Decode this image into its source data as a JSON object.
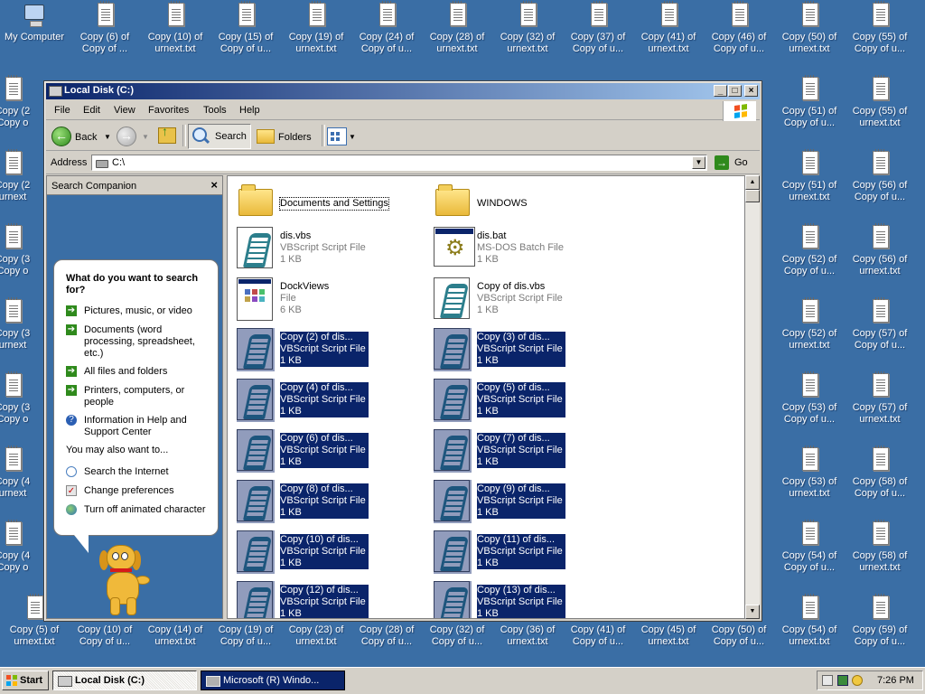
{
  "desktop": {
    "my_computer": "My Computer",
    "top_row": [
      [
        "Copy (6) of",
        "Copy of ..."
      ],
      [
        "Copy (10) of",
        "urnext.txt"
      ],
      [
        "Copy (15) of",
        "Copy of u..."
      ],
      [
        "Copy (19) of",
        "urnext.txt"
      ],
      [
        "Copy (24) of",
        "Copy of u..."
      ],
      [
        "Copy (28) of",
        "urnext.txt"
      ],
      [
        "Copy (32) of",
        "urnext.txt"
      ],
      [
        "Copy (37) of",
        "Copy of u..."
      ],
      [
        "Copy (41) of",
        "urnext.txt"
      ],
      [
        "Copy (46) of",
        "Copy of u..."
      ],
      [
        "Copy (50) of",
        "urnext.txt"
      ],
      [
        "Copy (55) of",
        "Copy of u..."
      ]
    ],
    "left_col": [
      [
        "Copy (2",
        "Copy o"
      ],
      [
        "Copy (2",
        "urnext"
      ],
      [
        "Copy (3",
        "Copy o"
      ],
      [
        "Copy (3",
        "urnext"
      ],
      [
        "Copy (3",
        "Copy o"
      ],
      [
        "Copy (4",
        "urnext"
      ],
      [
        "Copy (4",
        "Copy o"
      ]
    ],
    "right_col_a": [
      [
        "Copy (51) of",
        "Copy of u..."
      ],
      [
        "Copy (51) of",
        "urnext.txt"
      ],
      [
        "Copy (52) of",
        "Copy of u..."
      ],
      [
        "Copy (52) of",
        "urnext.txt"
      ],
      [
        "Copy (53) of",
        "Copy of u..."
      ],
      [
        "Copy (53) of",
        "urnext.txt"
      ],
      [
        "Copy (54) of",
        "Copy of u..."
      ]
    ],
    "right_col_b": [
      [
        "Copy (55) of",
        "urnext.txt"
      ],
      [
        "Copy (56) of",
        "Copy of u..."
      ],
      [
        "Copy (56) of",
        "urnext.txt"
      ],
      [
        "Copy (57) of",
        "Copy of u..."
      ],
      [
        "Copy (57) of",
        "urnext.txt"
      ],
      [
        "Copy (58) of",
        "Copy of u..."
      ],
      [
        "Copy (58) of",
        "urnext.txt"
      ]
    ],
    "bottom_row": [
      [
        "Copy (5) of",
        "urnext.txt"
      ],
      [
        "Copy (10) of",
        "Copy of u..."
      ],
      [
        "Copy (14) of",
        "urnext.txt"
      ],
      [
        "Copy (19) of",
        "Copy of u..."
      ],
      [
        "Copy (23) of",
        "urnext.txt"
      ],
      [
        "Copy (28) of",
        "Copy of u..."
      ],
      [
        "Copy (32) of",
        "Copy of u..."
      ],
      [
        "Copy (36) of",
        "urnext.txt"
      ],
      [
        "Copy (41) of",
        "Copy of u..."
      ],
      [
        "Copy (45) of",
        "urnext.txt"
      ],
      [
        "Copy (50) of",
        "Copy of u..."
      ],
      [
        "Copy (54) of",
        "urnext.txt"
      ],
      [
        "Copy (59) of",
        "Copy of u..."
      ]
    ]
  },
  "window": {
    "title": "Local Disk (C:)",
    "menu": [
      "File",
      "Edit",
      "View",
      "Favorites",
      "Tools",
      "Help"
    ],
    "toolbar": {
      "back": "Back",
      "search": "Search",
      "folders": "Folders"
    },
    "address_label": "Address",
    "address_value": "C:\\",
    "go_label": "Go"
  },
  "companion": {
    "title": "Search Companion",
    "close": "×",
    "question": "What do you want to search for?",
    "options": [
      "Pictures, music, or video",
      "Documents (word processing, spreadsheet, etc.)",
      "All files and folders",
      "Printers, computers, or people",
      "Information in Help and Support Center"
    ],
    "also_label": "You may also want to...",
    "also": [
      "Search the Internet",
      "Change preferences",
      "Turn off animated character"
    ]
  },
  "files": [
    {
      "name": "Documents and Settings",
      "type": "",
      "size": "",
      "icon": "folder",
      "selected": false
    },
    {
      "name": "WINDOWS",
      "type": "",
      "size": "",
      "icon": "folder",
      "selected": false
    },
    {
      "name": "dis.vbs",
      "type": "VBScript Script File",
      "size": "1 KB",
      "icon": "vbs",
      "selected": false
    },
    {
      "name": "dis.bat",
      "type": "MS-DOS Batch File",
      "size": "1 KB",
      "icon": "bat",
      "selected": false
    },
    {
      "name": "DockViews",
      "type": "File",
      "size": "6 KB",
      "icon": "file",
      "selected": false
    },
    {
      "name": "Copy of dis.vbs",
      "type": "VBScript Script File",
      "size": "1 KB",
      "icon": "vbs",
      "selected": false
    },
    {
      "name": "Copy (2) of dis...",
      "type": "VBScript Script File",
      "size": "1 KB",
      "icon": "vbs",
      "selected": true
    },
    {
      "name": "Copy (3) of dis...",
      "type": "VBScript Script File",
      "size": "1 KB",
      "icon": "vbs",
      "selected": true
    },
    {
      "name": "Copy (4) of dis...",
      "type": "VBScript Script File",
      "size": "1 KB",
      "icon": "vbs",
      "selected": true
    },
    {
      "name": "Copy (5) of dis...",
      "type": "VBScript Script File",
      "size": "1 KB",
      "icon": "vbs",
      "selected": true
    },
    {
      "name": "Copy (6) of dis...",
      "type": "VBScript Script File",
      "size": "1 KB",
      "icon": "vbs",
      "selected": true
    },
    {
      "name": "Copy (7) of dis...",
      "type": "VBScript Script File",
      "size": "1 KB",
      "icon": "vbs",
      "selected": true
    },
    {
      "name": "Copy (8) of dis...",
      "type": "VBScript Script File",
      "size": "1 KB",
      "icon": "vbs",
      "selected": true
    },
    {
      "name": "Copy (9) of dis...",
      "type": "VBScript Script File",
      "size": "1 KB",
      "icon": "vbs",
      "selected": true
    },
    {
      "name": "Copy (10) of dis...",
      "type": "VBScript Script File",
      "size": "1 KB",
      "icon": "vbs",
      "selected": true
    },
    {
      "name": "Copy (11) of dis...",
      "type": "VBScript Script File",
      "size": "1 KB",
      "icon": "vbs",
      "selected": true
    },
    {
      "name": "Copy (12) of dis...",
      "type": "VBScript Script File",
      "size": "1 KB",
      "icon": "vbs",
      "selected": true
    },
    {
      "name": "Copy (13) of dis...",
      "type": "VBScript Script File",
      "size": "1 KB",
      "icon": "vbs",
      "selected": true
    }
  ],
  "taskbar": {
    "start": "Start",
    "tasks": [
      "Local Disk (C:)",
      "Microsoft (R) Windo..."
    ],
    "clock": "7:26 PM"
  }
}
